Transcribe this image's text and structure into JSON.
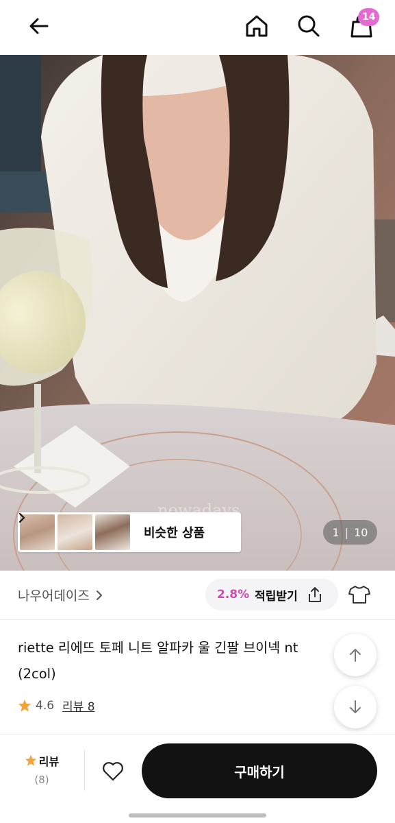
{
  "header": {
    "back_icon": "arrow-left-icon",
    "home_icon": "home-icon",
    "search_icon": "search-icon",
    "cart_icon": "shopping-bag-icon",
    "cart_count": "14",
    "badge_color": "#e36ad2"
  },
  "gallery": {
    "watermark": "nowadays",
    "similar_label": "비슷한 상품",
    "current_page": "1",
    "separator": "|",
    "total_pages": "10"
  },
  "brand": {
    "name": "나우어데이즈",
    "points_rate": "2.8%",
    "points_label": "적립받기",
    "accent_color": "#c84bb8"
  },
  "product": {
    "title": "riette 리에뜨 토페 니트 알파카 울 긴팔 브이넥 nt (2col)",
    "rating": "4.6",
    "review_link": "리뷰 8"
  },
  "bottom_bar": {
    "review_label": "리뷰",
    "review_count": "(8)",
    "buy_label": "구매하기",
    "star_color": "#f2a33a"
  }
}
